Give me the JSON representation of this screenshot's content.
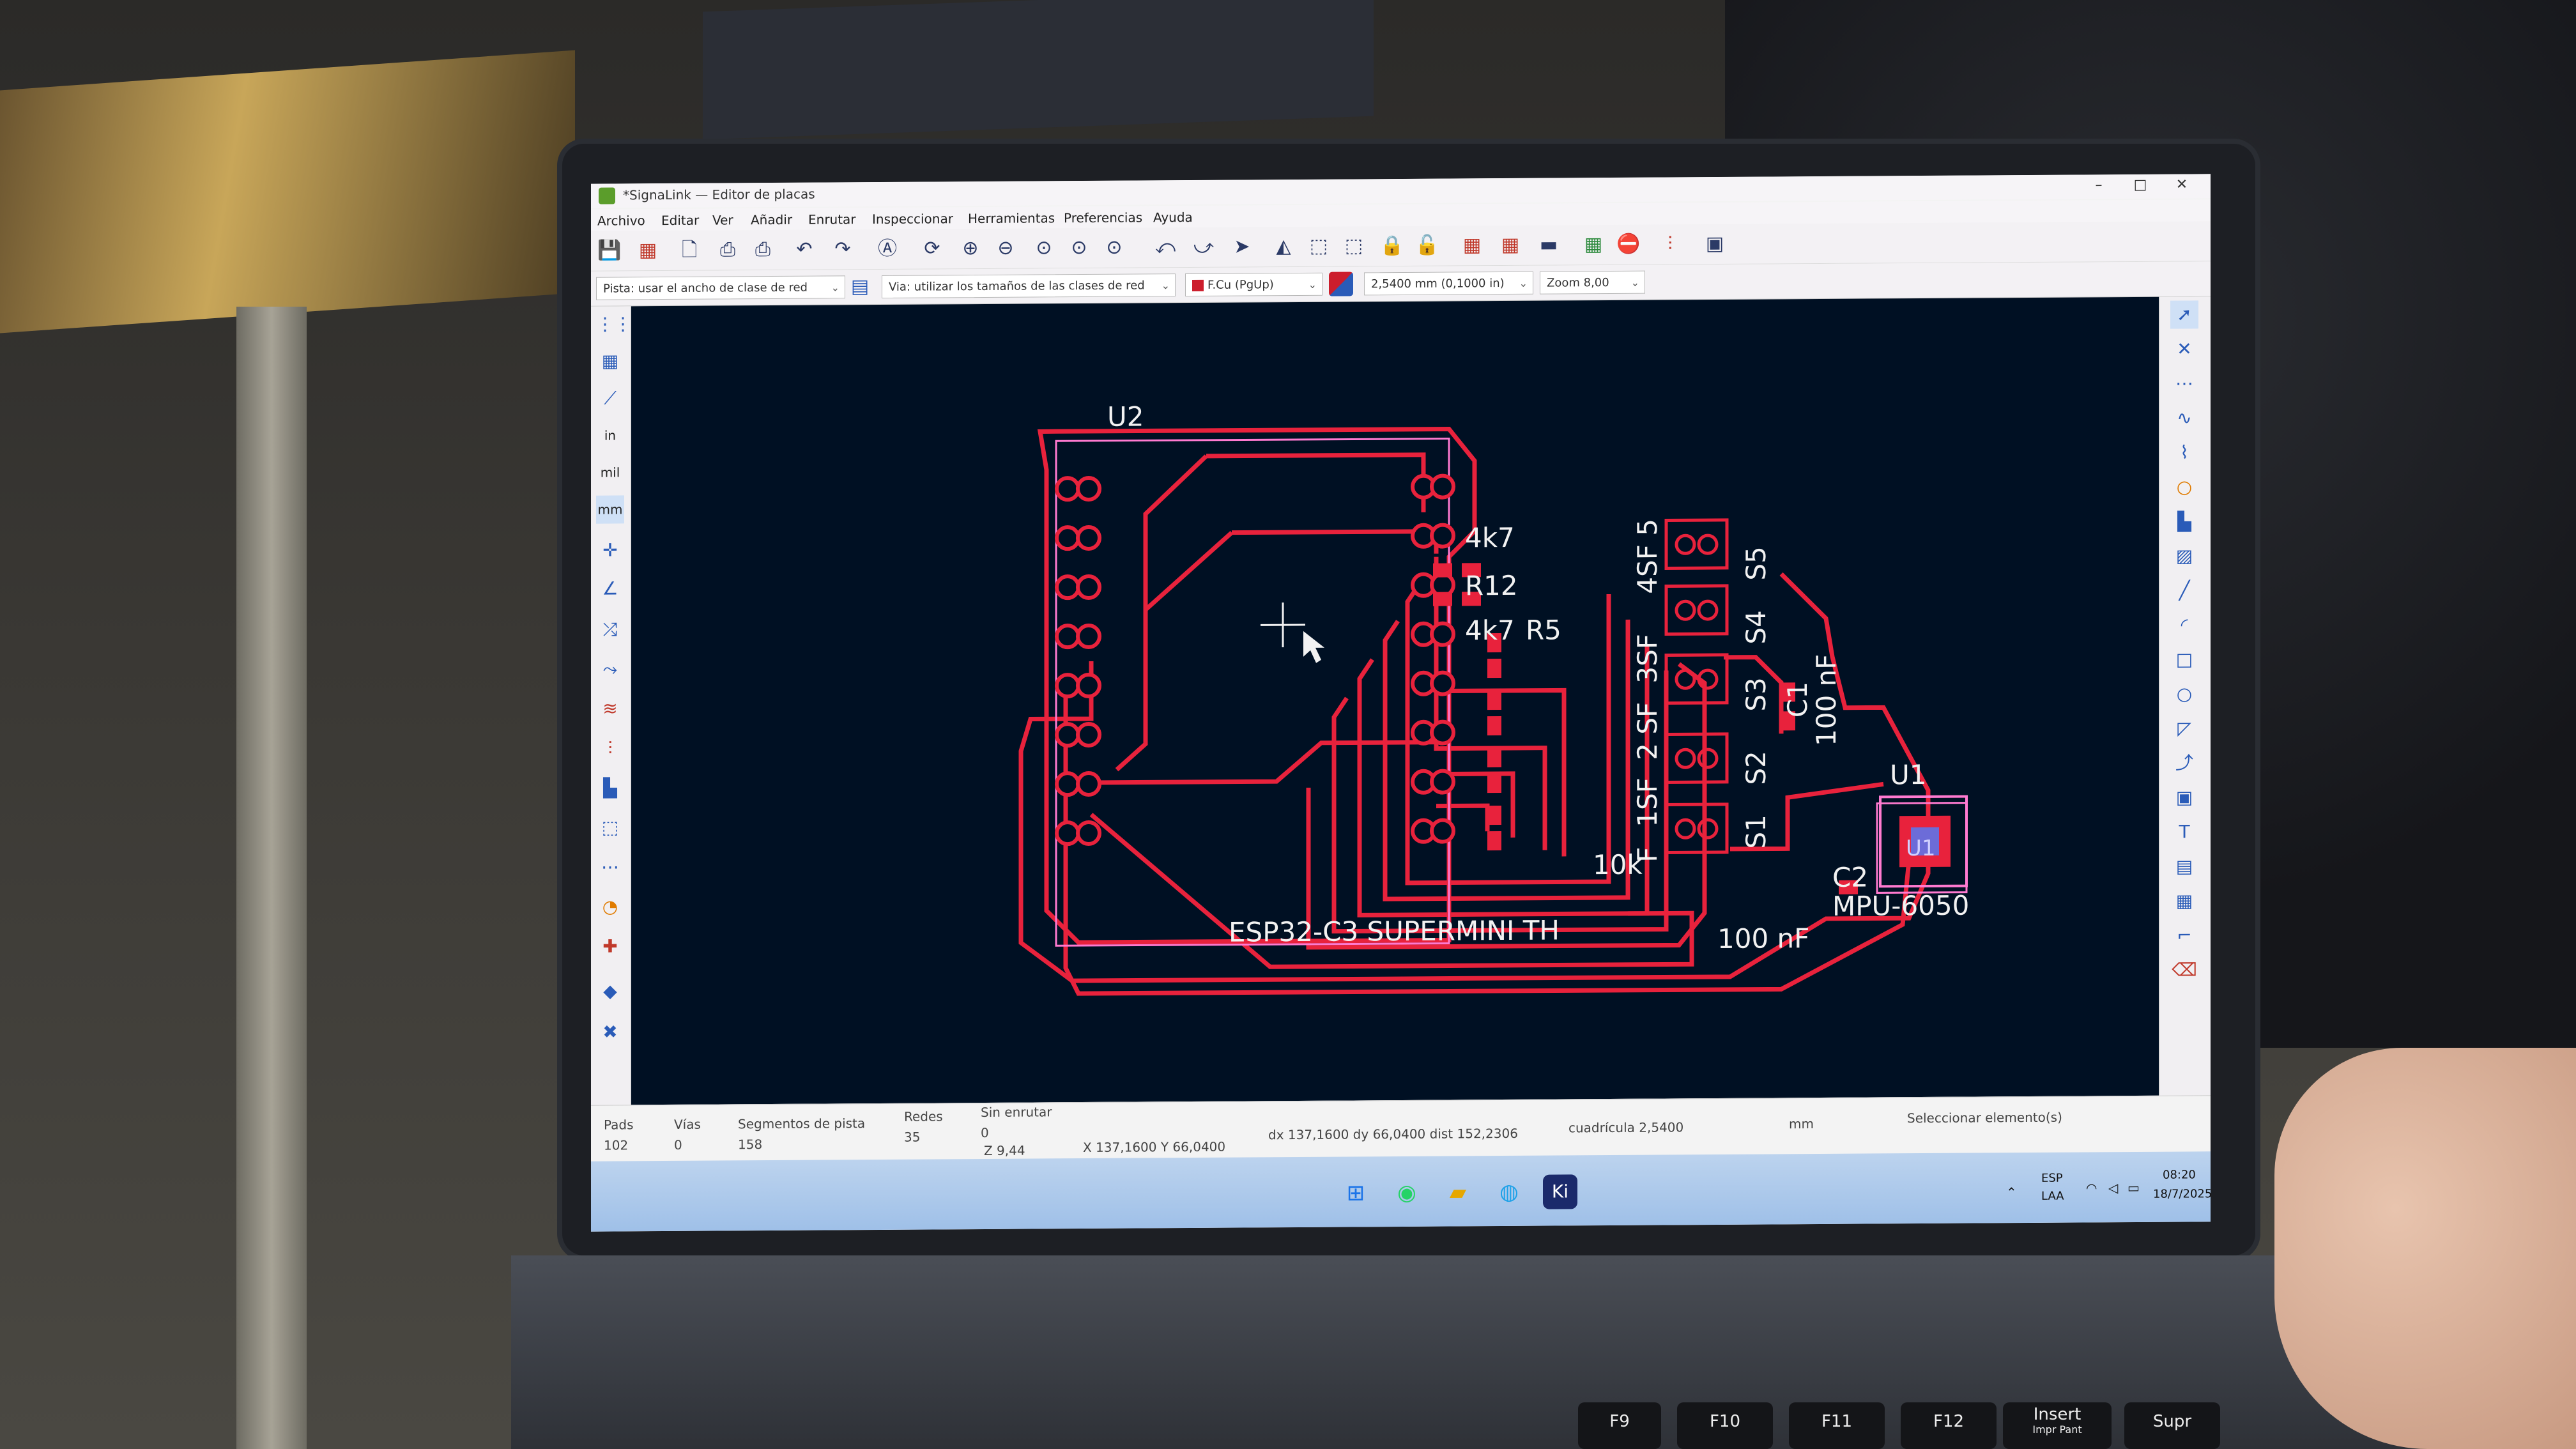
{
  "window": {
    "title": "*SignaLink — Editor de placas",
    "min": "–",
    "max": "□",
    "close": "✕"
  },
  "menu": [
    "Archivo",
    "Editar",
    "Ver",
    "Añadir",
    "Enrutar",
    "Inspeccionar",
    "Herramientas",
    "Preferencias",
    "Ayuda"
  ],
  "toolbar": {
    "track_width": "Pista: usar el ancho de clase de red",
    "via_size": "Via: utilizar los tamaños de las clases de red",
    "layer": "F.Cu (PgUp)",
    "grid": "2,5400 mm (0,1000 in)",
    "zoom": "Zoom 8,00"
  },
  "left_tools": {
    "in": "in",
    "mil": "mil",
    "mm": "mm"
  },
  "pcb": {
    "refs": {
      "u2": "U2",
      "r_4k7_a": "4k7",
      "r_r12": "R12",
      "r_4k7_b": "4k7",
      "r_r5": "R5",
      "sw5": "4SF 5",
      "sw4": "3SF",
      "sw3": "2 SF",
      "sw2": "1SF",
      "sw1": "F",
      "res_10k": "10k",
      "s5": "S5",
      "s4": "S4",
      "s3": "S3",
      "s2": "S2",
      "s1": "S1",
      "c1": "C1",
      "c1_val": "100 nF",
      "u1": "U1",
      "u1_tag": "U1",
      "mpu": "MPU-6050",
      "c2": "C2",
      "c2_val": "100 nF",
      "esp": "ESP32-C3 SUPERMINI TH"
    }
  },
  "status": {
    "pads_label": "Pads",
    "pads_value": "102",
    "vias_label": "Vías",
    "vias_value": "0",
    "segments_label": "Segmentos de pista",
    "segments_value": "158",
    "nets_label": "Redes",
    "nets_value": "35",
    "unrouted_label": "Sin enrutar",
    "unrouted_value": "0",
    "zoom": "Z 9,44",
    "xy": "X 137,1600  Y 66,0400",
    "dxdy": "dx 137,1600  dy 66,0400  dist 152,2306",
    "grid": "cuadrícula 2,5400",
    "units": "mm",
    "hint": "Seleccionar elemento(s)"
  },
  "taskbar": {
    "lang1": "ESP",
    "lang2": "LAA",
    "time": "08:20",
    "date": "18/7/2025",
    "kicad": "Ki"
  },
  "keyboard": {
    "f9": "F9",
    "f10": "F10",
    "f11": "F11",
    "f12": "F12",
    "insert": "Insert",
    "impr": "Impr Pant",
    "supr": "Supr"
  },
  "colors": {
    "copper": "#e8223c",
    "silk": "#f2f2f2",
    "pcb_bg": "#001023",
    "courtyard": "#ff7ad0"
  }
}
